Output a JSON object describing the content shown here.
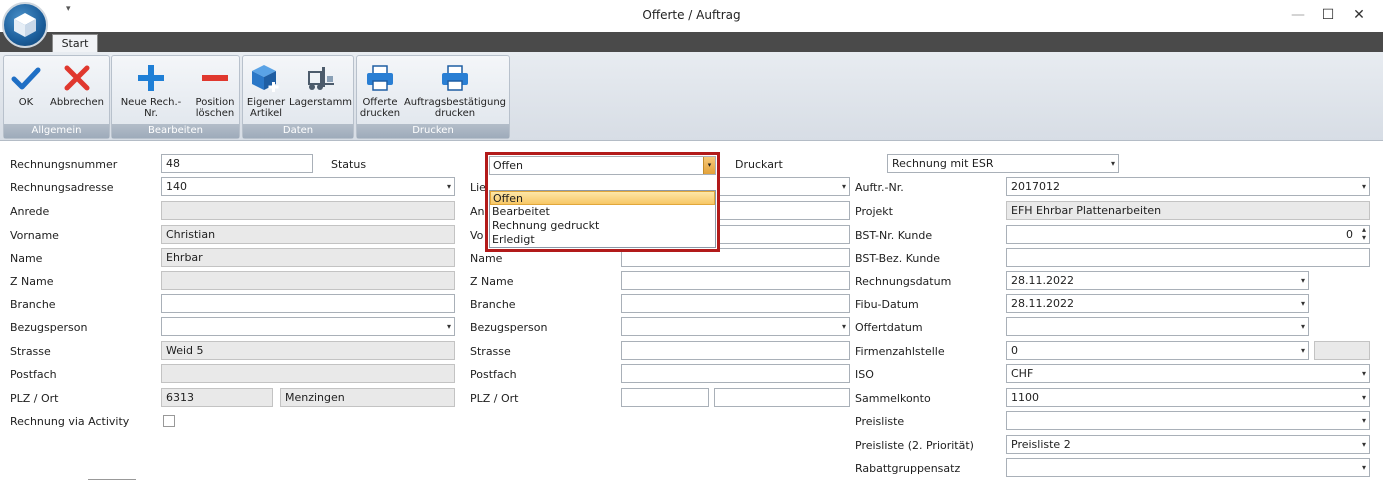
{
  "window": {
    "title": "Offerte / Auftrag",
    "qa_glyph": "▾",
    "minimize": "—",
    "maximize": "☐",
    "close": "✕"
  },
  "tabs": {
    "start": "Start"
  },
  "ribbon": {
    "groups": {
      "allgemein": "Allgemein",
      "bearbeiten": "Bearbeiten",
      "daten": "Daten",
      "drucken": "Drucken"
    },
    "buttons": {
      "ok": "OK",
      "abbrechen": "Abbrechen",
      "neue_rech_nr": "Neue Rech.-Nr.",
      "position_loeschen_1": "Position",
      "position_loeschen_2": "löschen",
      "eigener_artikel_1": "Eigener",
      "eigener_artikel_2": "Artikel",
      "lagerstamm": "Lagerstamm",
      "offerte_drucken_1": "Offerte",
      "offerte_drucken_2": "drucken",
      "auftragsbestaetigung_1": "Auftragsbestätigung",
      "auftragsbestaetigung_2": "drucken"
    }
  },
  "form": {
    "left": {
      "rechnungsnummer": {
        "label": "Rechnungsnummer",
        "value": "48"
      },
      "rechnungsadresse": {
        "label": "Rechnungsadresse",
        "value": "140"
      },
      "anrede": {
        "label": "Anrede",
        "value": ""
      },
      "vorname": {
        "label": "Vorname",
        "value": "Christian"
      },
      "name": {
        "label": "Name",
        "value": "Ehrbar"
      },
      "z_name": {
        "label": "Z Name",
        "value": ""
      },
      "branche": {
        "label": "Branche",
        "value": ""
      },
      "bezugsperson": {
        "label": "Bezugsperson",
        "value": ""
      },
      "strasse": {
        "label": "Strasse",
        "value": "Weid 5"
      },
      "postfach": {
        "label": "Postfach",
        "value": ""
      },
      "plz_ort": {
        "label": "PLZ / Ort",
        "plz": "6313",
        "ort": "Menzingen"
      },
      "rechnung_via_activity": {
        "label": "Rechnung via Activity",
        "checked": false
      }
    },
    "middle": {
      "status_label": "Status",
      "liefer_label_partial": "Lie",
      "anrede_label_partial": "An",
      "vorname_label_partial": "Vo",
      "name": "Name",
      "z_name": "Z Name",
      "branche": "Branche",
      "bezugsperson": "Bezugsperson",
      "strasse": "Strasse",
      "postfach": "Postfach",
      "plz_ort": "PLZ / Ort"
    },
    "status": {
      "value": "Offen",
      "options": [
        "Offen",
        "Bearbeitet",
        "Rechnung gedruckt",
        "Erledigt"
      ],
      "selected_index": 0
    },
    "druckart": {
      "label": "Druckart",
      "value": "Rechnung mit ESR"
    },
    "right": {
      "auftr_nr": {
        "label": "Auftr.-Nr.",
        "value": "2017012"
      },
      "projekt": {
        "label": "Projekt",
        "value": "EFH Ehrbar Plattenarbeiten"
      },
      "bst_nr_kunde": {
        "label": "BST-Nr. Kunde",
        "value": "0"
      },
      "bst_bez_kunde": {
        "label": "BST-Bez. Kunde",
        "value": ""
      },
      "rechnungsdatum": {
        "label": "Rechnungsdatum",
        "value": "28.11.2022"
      },
      "fibu_datum": {
        "label": "Fibu-Datum",
        "value": "28.11.2022"
      },
      "offertdatum": {
        "label": "Offertdatum",
        "value": ""
      },
      "firmenzahlstelle": {
        "label": "Firmenzahlstelle",
        "value": "0"
      },
      "iso": {
        "label": "ISO",
        "value": "CHF"
      },
      "sammelkonto": {
        "label": "Sammelkonto",
        "value": "1100"
      },
      "preisliste": {
        "label": "Preisliste",
        "value": ""
      },
      "preisliste_2": {
        "label": "Preisliste (2. Priorität)",
        "value": "Preisliste 2"
      },
      "rabattgruppensatz": {
        "label": "Rabattgruppensatz",
        "value": ""
      }
    }
  },
  "colors": {
    "highlight_border": "#b21a1a",
    "ribbon_label": "#9eabbb",
    "tab_strip": "#4a4a4a"
  }
}
